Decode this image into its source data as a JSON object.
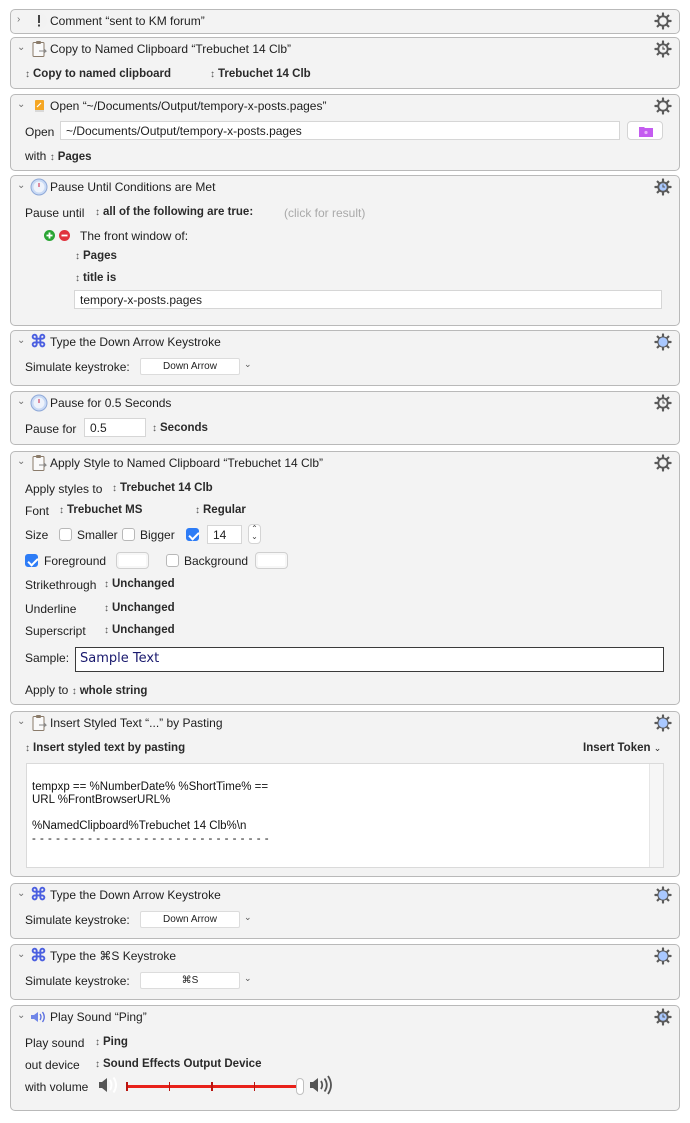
{
  "actions": [
    {
      "id": "comment",
      "title": "Comment “sent to KM forum”",
      "collapsed": true,
      "icon": "exclamation-icon",
      "gear": "gear-icon"
    },
    {
      "id": "copy-named-clipboard",
      "title": "Copy to Named Clipboard “Trebuchet 14 Clb”",
      "icon": "clipboard-icon",
      "gear": "gear-clock-icon",
      "mode_popup": "Copy to named clipboard",
      "clipboard_popup": "Trebuchet 14 Clb"
    },
    {
      "id": "open-file",
      "title": "Open “~/Documents/Output/tempory-x-posts.pages”",
      "icon": "document-icon",
      "gear": "gear-icon",
      "open_label": "Open",
      "path_value": "~/Documents/Output/tempory-x-posts.pages",
      "with_label": "with",
      "app_popup": "Pages"
    },
    {
      "id": "pause-until",
      "title": "Pause Until Conditions are Met",
      "icon": "clock-icon",
      "gear": "gear-clock-icon",
      "pause_label": "Pause until",
      "condition_popup": "all of the following are true:",
      "result_hint": "(click for result)",
      "condition_label": "The front window of:",
      "app_popup": "Pages",
      "test_popup": "title is",
      "value": "tempory-x-posts.pages"
    },
    {
      "id": "type-down-1",
      "title": "Type the Down Arrow Keystroke",
      "icon": "command-icon",
      "gear": "gear-blue-icon",
      "label": "Simulate keystroke:",
      "keystroke": "Down Arrow"
    },
    {
      "id": "pause-for",
      "title": "Pause for 0.5 Seconds",
      "icon": "clock-icon",
      "gear": "gear-clock-icon",
      "label": "Pause for",
      "value": "0.5",
      "unit_popup": "Seconds"
    },
    {
      "id": "apply-style",
      "title": "Apply Style to Named Clipboard “Trebuchet 14 Clb”",
      "icon": "clipboard-icon",
      "gear": "gear-icon",
      "apply_styles_label": "Apply styles to",
      "clipboard_popup": "Trebuchet 14 Clb",
      "font_label": "Font",
      "font_popup": "Trebuchet MS",
      "weight_popup": "Regular",
      "size_label": "Size",
      "smaller_label": "Smaller",
      "smaller_checked": false,
      "bigger_label": "Bigger",
      "bigger_checked": false,
      "size_checked": true,
      "size_value": "14",
      "foreground_label": "Foreground",
      "foreground_checked": true,
      "background_label": "Background",
      "background_checked": false,
      "strikethrough_label": "Strikethrough",
      "strikethrough_popup": "Unchanged",
      "underline_label": "Underline",
      "underline_popup": "Unchanged",
      "superscript_label": "Superscript",
      "superscript_popup": "Unchanged",
      "sample_label": "Sample:",
      "sample_text": "Sample Text",
      "sample_color": "#1a1a6e",
      "apply_to_label": "Apply to",
      "apply_to_popup": "whole string"
    },
    {
      "id": "insert-styled",
      "title": "Insert Styled Text “...” by Pasting",
      "icon": "clipboard-icon",
      "gear": "gear-blue-icon",
      "mode_popup": "Insert styled text by pasting",
      "insert_token": "Insert Token",
      "text_lines": [
        "",
        "tempxp == %NumberDate% %ShortTime% ==",
        "URL %FrontBrowserURL%",
        "",
        "%NamedClipboard%Trebuchet 14 Clb%\\n",
        "- - - - - - - - - - - - - - - - - - - - - - - - - - - - - -"
      ]
    },
    {
      "id": "type-down-2",
      "title": "Type the Down Arrow Keystroke",
      "icon": "command-icon",
      "gear": "gear-blue-icon",
      "label": "Simulate keystroke:",
      "keystroke": "Down Arrow"
    },
    {
      "id": "type-cmd-s",
      "title": "Type the ⌘S Keystroke",
      "icon": "command-icon",
      "gear": "gear-blue-icon",
      "label": "Simulate keystroke:",
      "keystroke": "⌘S"
    },
    {
      "id": "play-sound",
      "title": "Play Sound “Ping”",
      "icon": "speaker-icon",
      "gear": "gear-clock-icon",
      "play_label": "Play sound",
      "sound_popup": "Ping",
      "device_label": "out device",
      "device_popup": "Sound Effects Output Device",
      "volume_label": "with volume",
      "volume_percent": 100
    }
  ],
  "colors": {
    "command_icon": "#4b5fe0",
    "volume_track": "#e8211a",
    "checkbox_on": "#2d7cf6",
    "gear_blue": "#a9c8ff",
    "add_green": "#2aa534",
    "remove_red": "#e0333d",
    "folder_purple": "#c45cf0"
  }
}
